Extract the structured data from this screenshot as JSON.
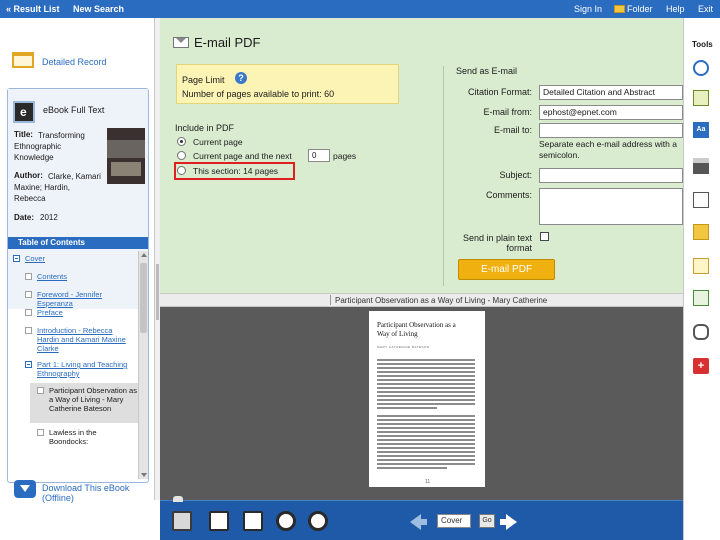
{
  "topbar": {
    "result_list": "« Result List",
    "new_search": "New Search",
    "sign_in": "Sign In",
    "folder": "Folder",
    "help": "Help",
    "exit": "Exit"
  },
  "left": {
    "detailed_record": "Detailed Record",
    "ebook_full_text": "eBook Full Text",
    "title_label": "Title:",
    "title": "Transforming Ethnographic Knowledge",
    "author_label": "Author:",
    "author": "Clarke, Kamari Maxine; Hardin, Rebecca",
    "date_label": "Date:",
    "date": "2012",
    "toc_header": "Table of Contents",
    "toc": [
      "Cover",
      "Contents",
      "Foreword - Jennifer Esperanza",
      "Preface",
      "Introduction - Rebecca Hardin and Kamari Maxine Clarke",
      "Part 1: Living and Teaching Ethnography",
      "Participant Observation as a Way of Living - Mary Catherine Bateson",
      "Lawless in the Boondocks:"
    ],
    "download": "Download This eBook (Offline)"
  },
  "email": {
    "title": "E-mail PDF",
    "page_limit_label": "Page Limit",
    "page_limit_text": "Number of pages available to print: 60",
    "include_label": "Include in PDF",
    "option_current": "Current page",
    "option_next_prefix": "Current page and the next",
    "option_next_value": "0",
    "option_next_suffix": "pages",
    "option_section": "This section: 14 pages",
    "send_as": "Send as E-mail",
    "citation_label": "Citation Format:",
    "citation_value": "Detailed Citation and Abstract",
    "from_label": "E-mail from:",
    "from_value": "ephost@epnet.com",
    "to_label": "E-mail to:",
    "to_hint": "Separate each e-mail address with a semicolon.",
    "subject_label": "Subject:",
    "comments_label": "Comments:",
    "plain_text_label": "Send in plain text format",
    "submit": "E-mail PDF"
  },
  "viewer": {
    "section_label": "Participant Observation as a Way of Living - Mary Catherine",
    "page_title": "Participant Observation as a Way of Living",
    "page_byline": "MARY CATHERINE BATESON",
    "page_number": "11",
    "nav_input": "Cover",
    "go": "Go"
  },
  "tools": {
    "label": "Tools"
  },
  "colors": {
    "topbar": "#2a6cc0",
    "email_panel": "#d9ecd0",
    "page_limit_box": "#fcf4b4",
    "email_button": "#f0b010",
    "highlight": "#e02020",
    "bottom_bar": "#1f5aa8",
    "viewer_bg": "#5a5a5a"
  },
  "icons": {
    "folder": "folder-icon",
    "detailed_record": "document-icon",
    "ebook": "ebook-icon",
    "download": "download-icon",
    "email": "mail-icon",
    "help": "help-icon",
    "tools": [
      "search-icon",
      "print-preview-icon",
      "dictionary-icon",
      "print-icon",
      "email-icon",
      "save-folder-icon",
      "cite-icon",
      "export-icon",
      "permalink-icon",
      "share-icon"
    ],
    "bottom": [
      "fullscreen-icon",
      "fit-width-icon",
      "fit-page-icon",
      "zoom-out-icon",
      "zoom-in-icon",
      "prev-arrow-icon",
      "next-arrow-icon"
    ]
  }
}
